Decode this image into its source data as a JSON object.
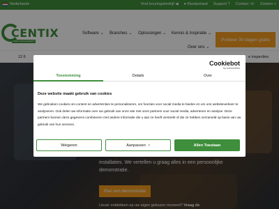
{
  "topbar": {
    "language": "Nederlands",
    "links": [
      "Vind keuringsbedrijf",
      "Klantportaal",
      "Support",
      "Contact",
      "Zoeken"
    ]
  },
  "header": {
    "logo_text": "CENTIX",
    "logo_tagline": "ASSET MANAGEMENT",
    "nav": [
      "Software",
      "Branches",
      "Oplossingen",
      "Kennis & Inspiratie",
      "Over ons"
    ],
    "cta": "Probeer 30 dagen gratis"
  },
  "strip": {
    "left": "12.6",
    "right": "e inspecties"
  },
  "hero": {
    "text": "installaties. We vertellen u graag alles in een persoonlijke demonstratie.",
    "button": "Plan een demonstratie",
    "sub_text": "Liever ontdekken op uw eigen gekozen moment?",
    "sub_bold": "Vraag de"
  },
  "cookie": {
    "brand": "Cookiebot",
    "brand_by": "by Usercentrics",
    "tabs": [
      "Toestemming",
      "Details",
      "Over"
    ],
    "title": "Deze website maakt gebruik van cookies",
    "body": "We gebruiken cookies om content en advertenties te personaliseren, om functies voor social media te bieden en om ons websiteverkeer te analyseren. Ook delen we informatie over uw gebruik van onze site met onze partners voor social media, adverteren en analyse. Deze partners kunnen deze gegevens combineren met andere informatie die u aan ze heeft verstrekt of die ze hebben verzameld op basis van uw gebruik van hun services.",
    "buttons": {
      "deny": "Weigeren",
      "customize": "Aanpassen",
      "allow": "Allen Toestaan"
    }
  },
  "colors": {
    "brand_green": "#3e8e3b",
    "accent_orange": "#f39c1f"
  }
}
